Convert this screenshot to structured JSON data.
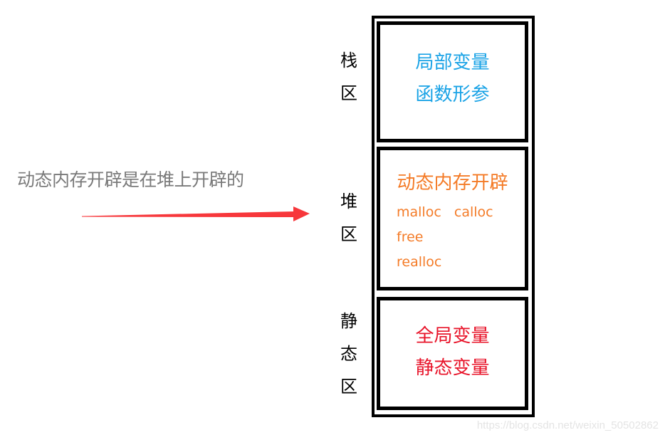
{
  "annotation": {
    "text": "动态内存开辟是在堆上开辟的",
    "arrow_color": "#f7373b",
    "text_color": "#7a7a7a"
  },
  "regions": [
    {
      "label_chars": [
        "栈",
        "区"
      ],
      "lines": [
        "局部变量",
        "函数形参"
      ],
      "color": "#1aa3e6"
    },
    {
      "label_chars": [
        "堆",
        "区"
      ],
      "title": "动态内存开辟",
      "functions": [
        "malloc   calloc",
        "free",
        "realloc"
      ],
      "color": "#f47b27"
    },
    {
      "label_chars": [
        "静",
        "态",
        "区"
      ],
      "lines": [
        "全局变量",
        "静态变量"
      ],
      "color": "#e8142a"
    }
  ],
  "watermark": "https://blog.csdn.net/weixin_50502862"
}
